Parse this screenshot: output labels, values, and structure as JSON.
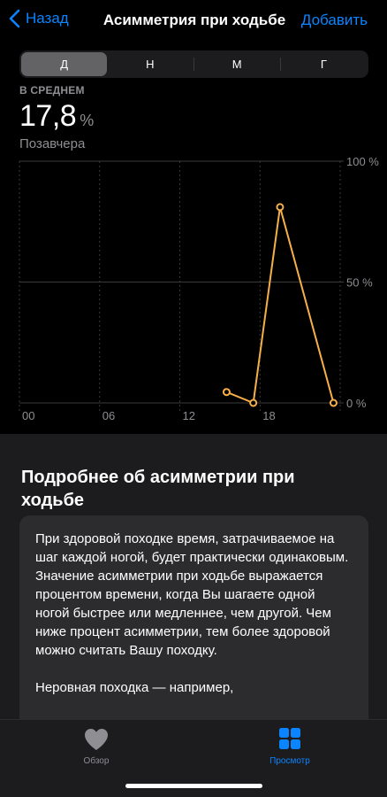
{
  "nav": {
    "back_label": "Назад",
    "title": "Асимметрия при ходьбе",
    "add_label": "Добавить"
  },
  "segments": [
    {
      "label": "Д",
      "active": true
    },
    {
      "label": "Н",
      "active": false
    },
    {
      "label": "М",
      "active": false
    },
    {
      "label": "Г",
      "active": false
    }
  ],
  "summary": {
    "label": "В СРЕДНЕМ",
    "value": "17,8",
    "unit": "%",
    "date": "Позавчера"
  },
  "chart_data": {
    "type": "line",
    "x_ticks": [
      "00",
      "06",
      "12",
      "18"
    ],
    "y_ticks": [
      "100 %",
      "50 %",
      "0 %"
    ],
    "ylim": [
      0,
      100
    ],
    "xlim": [
      0,
      24
    ],
    "series": [
      {
        "color": "#f7b049",
        "points": [
          [
            15.5,
            4.5
          ],
          [
            17.5,
            0
          ],
          [
            19.5,
            81
          ],
          [
            23.5,
            0
          ]
        ]
      }
    ]
  },
  "info": {
    "title": "Подробнее об асимметрии при ходьбе",
    "paragraph1": "При здоровой походке время, затрачиваемое на шаг каждой ногой, будет практически одинаковым. Значение асимметрии при ходьбе выражается процентом времени, когда Вы шагаете одной ногой быстрее или медленнее, чем другой. Чем ниже процент асимметрии, тем более здоровой можно считать Вашу походку.",
    "paragraph2": "Неровная походка — например,"
  },
  "tabbar": {
    "overview_label": "Обзор",
    "browse_label": "Просмотр"
  },
  "colors": {
    "accent": "#0a84ff",
    "series": "#f7b049"
  }
}
